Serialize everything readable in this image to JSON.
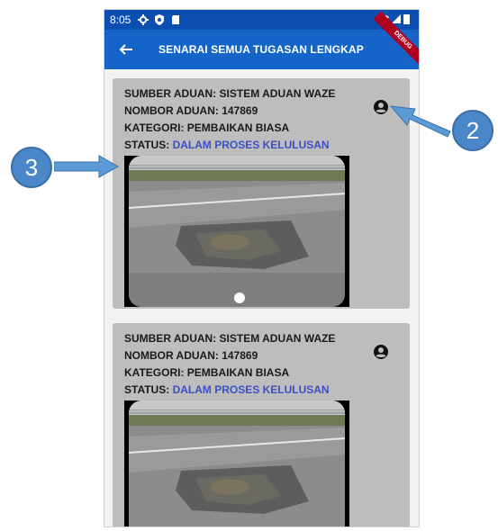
{
  "statusbar": {
    "time": "8:05"
  },
  "appbar": {
    "title": "SENARAI SEMUA TUGASAN LENGKAP",
    "debug_label": "DEBUG"
  },
  "cards": [
    {
      "source": "SUMBER ADUAN: SISTEM ADUAN WAZE",
      "number": "NOMBOR ADUAN: 147869",
      "category": "KATEGORI: PEMBAIKAN BIASA",
      "status_label": "STATUS:",
      "status_value": "DALAM PROSES KELULUSAN"
    },
    {
      "source": "SUMBER ADUAN: SISTEM ADUAN WAZE",
      "number": "NOMBOR ADUAN: 147869",
      "category": "KATEGORI: PEMBAIKAN BIASA",
      "status_label": "STATUS:",
      "status_value": "DALAM PROSES KELULUSAN"
    }
  ],
  "callouts": {
    "two": "2",
    "three": "3"
  },
  "colors": {
    "appbar": "#1565c9",
    "statusbar": "#0d4fb0",
    "card": "#bdbdbd",
    "status_value": "#3d4fc4",
    "callout": "#4a86c8"
  }
}
